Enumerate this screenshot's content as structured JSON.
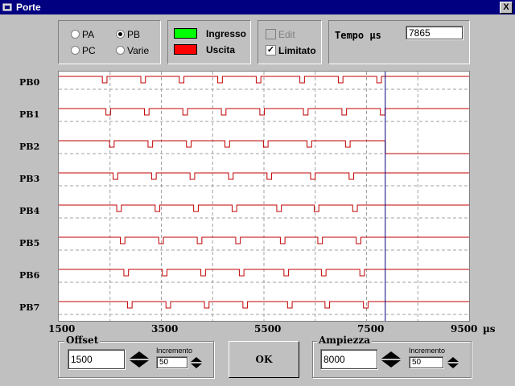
{
  "window": {
    "title": "Porte",
    "close_glyph": "X"
  },
  "ports": {
    "options": [
      "PA",
      "PB",
      "PC",
      "Varie"
    ],
    "selected": "PB"
  },
  "legend": {
    "input_label": "Ingresso",
    "output_label": "Uscita",
    "input_color": "#00ff00",
    "output_color": "#ff0000"
  },
  "options": {
    "edit_label": "Edit",
    "edit_checked": false,
    "edit_enabled": false,
    "limited_label": "Limitato",
    "limited_checked": true
  },
  "time": {
    "label": "Tempo µs",
    "value": "7865"
  },
  "chart_data": {
    "type": "line",
    "title": "",
    "xlabel": "µs",
    "xlim": [
      1500,
      9500
    ],
    "x_ticks": [
      "1500",
      "3500",
      "5500",
      "7500",
      "9500"
    ],
    "cursor_x": 7865,
    "signal_color": "#c00000",
    "grid_color": "#a0a0a0",
    "cursor_color": "#000080",
    "series": [
      {
        "name": "PB0",
        "high_before": true,
        "high_after": true,
        "pulses": [
          2350,
          3100,
          3850,
          4600,
          5350,
          6200,
          6950,
          7700
        ]
      },
      {
        "name": "PB1",
        "high_before": true,
        "high_after": true,
        "pulses": [
          2420,
          3170,
          3920,
          4670,
          5420,
          6270,
          7020,
          7770
        ]
      },
      {
        "name": "PB2",
        "high_before": true,
        "high_after": false,
        "pulses": [
          2490,
          3240,
          3990,
          4740,
          5490,
          6340,
          7090
        ]
      },
      {
        "name": "PB3",
        "high_before": true,
        "high_after": true,
        "pulses": [
          2560,
          3310,
          4060,
          4810,
          5560,
          6410,
          7160
        ]
      },
      {
        "name": "PB4",
        "high_before": true,
        "high_after": true,
        "pulses": [
          2630,
          3380,
          4130,
          4880,
          5750,
          6480,
          7230
        ]
      },
      {
        "name": "PB5",
        "high_before": true,
        "high_after": true,
        "pulses": [
          2700,
          3450,
          4200,
          4950,
          5820,
          6550,
          7300
        ]
      },
      {
        "name": "PB6",
        "high_before": true,
        "high_after": true,
        "pulses": [
          2770,
          3520,
          4270,
          5020,
          5890,
          6620,
          7370
        ]
      },
      {
        "name": "PB7",
        "high_before": true,
        "high_after": true,
        "pulses": [
          2840,
          3590,
          4340,
          5090,
          5960,
          6690,
          7440
        ]
      }
    ]
  },
  "offset": {
    "label": "Offset",
    "value": "1500",
    "increment_label": "Incremento",
    "increment_value": "50"
  },
  "amplitude": {
    "label": "Ampiezza",
    "value": "8000",
    "increment_label": "Incremento",
    "increment_value": "50"
  },
  "ok_label": "OK"
}
